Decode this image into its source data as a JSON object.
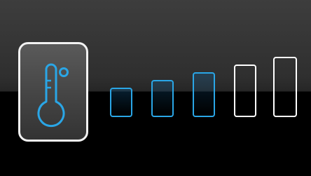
{
  "control": {
    "icon": "thermometer-icon",
    "setting": "temperature",
    "level": 3,
    "max_level": 5
  },
  "colors": {
    "active": "#2aa6e6",
    "inactive": "#ffffff",
    "tile_border": "#f2f2f2",
    "background_top": "#3d3d3d",
    "background_bottom": "#000000"
  },
  "levels": [
    {
      "index": 1,
      "state": "on"
    },
    {
      "index": 2,
      "state": "on"
    },
    {
      "index": 3,
      "state": "on"
    },
    {
      "index": 4,
      "state": "off"
    },
    {
      "index": 5,
      "state": "off"
    }
  ]
}
